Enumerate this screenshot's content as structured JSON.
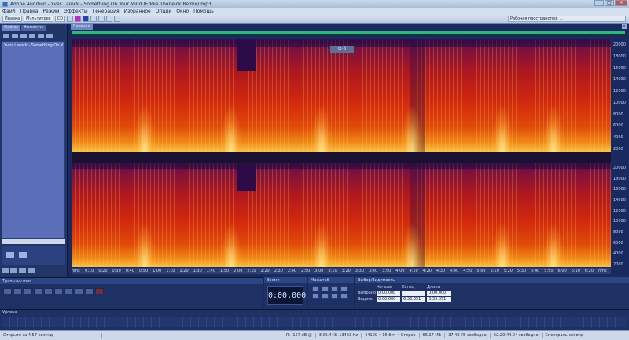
{
  "window": {
    "title": "Adobe Audition - Yves Larock - Something On Your Mind (Eddie Thoneick Remix).mp3",
    "buttons": [
      "_",
      "□",
      "✕"
    ]
  },
  "menu": [
    "Файл",
    "Правка",
    "Режим",
    "Эффекты",
    "Генерация",
    "Избранное",
    "Опции",
    "Окно",
    "Помощь"
  ],
  "toolbar": {
    "edit_label": "Правка",
    "multitrack_label": "Мультитрек",
    "cd_label": "CD",
    "workspace_label": "Рабочая пространство: ..."
  },
  "files_panel": {
    "tabs": [
      "Файлы",
      "Эффекты"
    ],
    "items": [
      "Yves Larock - Something On You"
    ]
  },
  "main_panel": {
    "tab": "Главная",
    "close": "×",
    "play_badge": "⏻ 0",
    "freq_ticks_top": [
      "20000",
      "18000",
      "16000",
      "14000",
      "12000",
      "10000",
      "8000",
      "6000",
      "4000",
      "2000"
    ],
    "freq_ticks_bottom": [
      "20000",
      "18000",
      "16000",
      "14000",
      "12000",
      "10000",
      "8000",
      "6000",
      "4000",
      "2000"
    ],
    "time_ticks": [
      "hms",
      "0:10",
      "0:20",
      "0:30",
      "0:40",
      "0:50",
      "1:00",
      "1:10",
      "1:20",
      "1:30",
      "1:40",
      "1:50",
      "2:00",
      "2:10",
      "2:20",
      "2:30",
      "2:40",
      "2:50",
      "3:00",
      "3:10",
      "3:20",
      "3:30",
      "3:40",
      "3:50",
      "4:00",
      "4:10",
      "4:20",
      "4:30",
      "4:40",
      "4:50",
      "5:00",
      "5:10",
      "5:20",
      "5:30",
      "5:40",
      "5:50",
      "6:00",
      "6:10",
      "6:20",
      "hms"
    ]
  },
  "transport": {
    "title": "Транспортная"
  },
  "time_panel": {
    "title": "Время",
    "value": "0:00.000"
  },
  "zoom_panel": {
    "title": "Масштаб"
  },
  "selection_panel": {
    "title": "Выбор/Видимость",
    "headers": [
      "",
      "Начало",
      "Конец",
      "Длина"
    ],
    "rows": [
      {
        "label": "Выбрано",
        "start": "0:00.000",
        "end": "",
        "length": "0:00.000"
      },
      {
        "label": "Видимо",
        "start": "0:00.000",
        "end": "6:33.351",
        "length": "6:33.351"
      }
    ]
  },
  "levels": {
    "title": "Уровни"
  },
  "status": [
    "Открыто за 4.57 секунд",
    "R: -157 dB @",
    "3:05.443, 13463 Hz",
    "44100 • 16-бит • Стерео",
    "66.17 МБ",
    "37.48 ГБ свободно",
    "62:29:44.04 свободно",
    "Спектральная вид"
  ]
}
